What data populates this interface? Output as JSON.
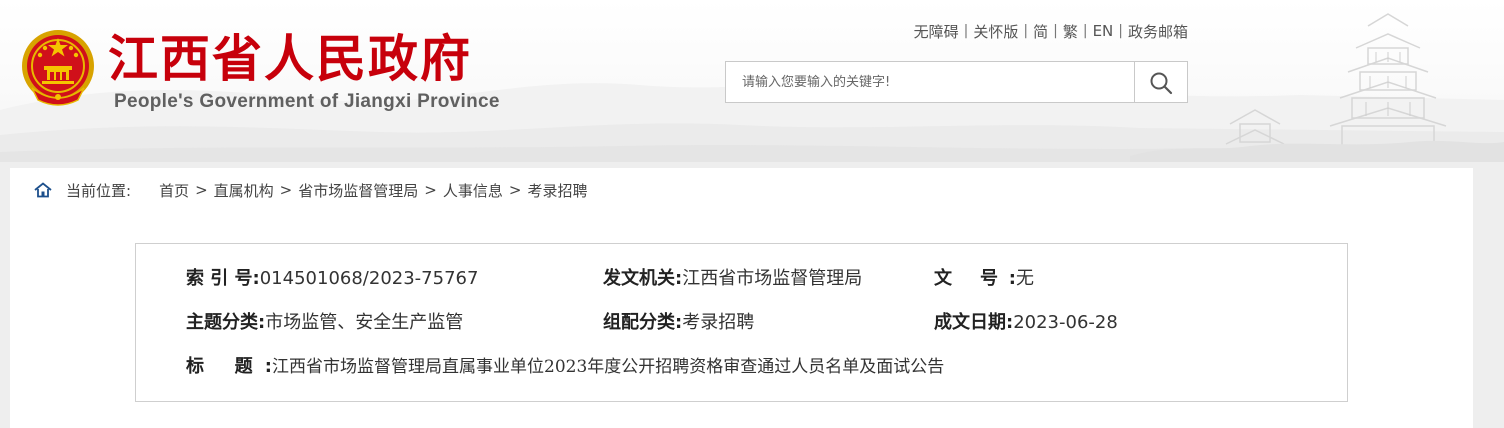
{
  "header": {
    "site_title": "江西省人民政府",
    "site_subtitle": "People's Government of Jiangxi Province",
    "top_links": [
      "无障碍",
      "关怀版",
      "简",
      "繁",
      "EN",
      "政务邮箱"
    ],
    "search": {
      "placeholder": "请输入您要输入的关键字!",
      "icon": "search-icon"
    },
    "colors": {
      "title_red": "#c7000b",
      "subtitle_gray": "#606060"
    }
  },
  "breadcrumb": {
    "prefix": "当前位置:",
    "separator": ">",
    "items": [
      "首页",
      "直属机构",
      "省市场监督管理局",
      "人事信息",
      "考录招聘"
    ]
  },
  "info": {
    "index_no": {
      "label": "索 引 号:",
      "value": "014501068/2023-75767"
    },
    "issuer": {
      "label": "发文机关:",
      "value": "江西省市场监督管理局"
    },
    "doc_no": {
      "label": "文 号:",
      "value": "无"
    },
    "topic": {
      "label": "主题分类:",
      "value": "市场监管、安全生产监管"
    },
    "category": {
      "label": "组配分类:",
      "value": "考录招聘"
    },
    "date": {
      "label": "成文日期:",
      "value": "2023-06-28"
    },
    "title": {
      "label": "标 题:",
      "value": "江西省市场监督管理局直属事业单位2023年度公开招聘资格审查通过人员名单及面试公告"
    }
  }
}
